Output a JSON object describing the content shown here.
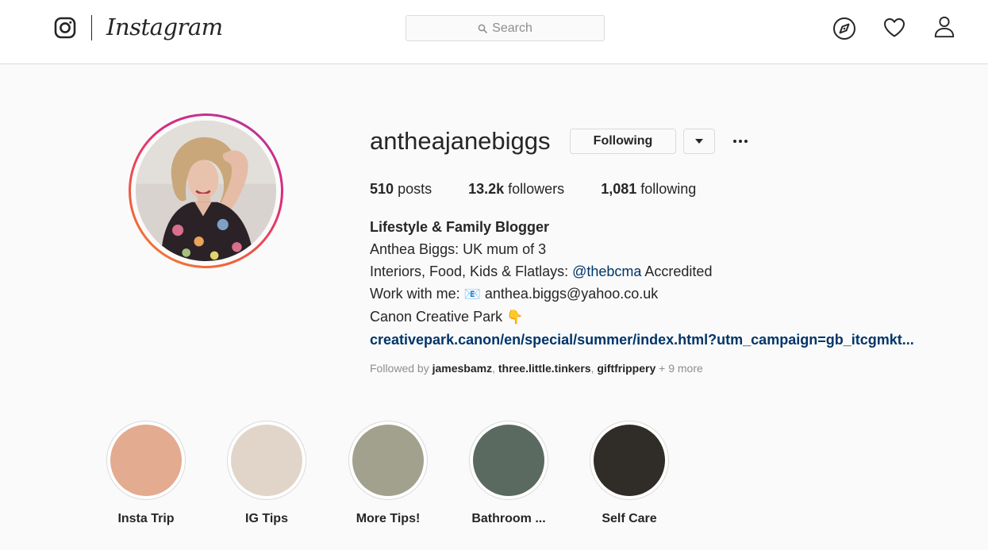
{
  "nav": {
    "logo_text": "Instagram",
    "search_placeholder": "Search",
    "icons": [
      "instagram-glyph-icon",
      "search-icon",
      "compass-icon",
      "heart-icon",
      "person-icon"
    ]
  },
  "profile": {
    "username": "antheajanebiggs",
    "following_button": "Following",
    "stats": [
      {
        "count": "510",
        "label": "posts"
      },
      {
        "count": "13.2k",
        "label": "followers"
      },
      {
        "count": "1,081",
        "label": "following"
      }
    ],
    "bio": {
      "name": "Lifestyle & Family Blogger",
      "line1": "Anthea Biggs: UK mum of 3",
      "line2_prefix": "Interiors, Food, Kids & Flatlays: ",
      "line2_mention": "@thebcma",
      "line2_suffix": " Accredited",
      "line3_prefix": "Work with me: ",
      "line3_emoji": "📧",
      "line3_email": " anthea.biggs@yahoo.co.uk",
      "line4_text": "Canon Creative Park ",
      "line4_emoji": "👇",
      "link": "creativepark.canon/en/special/summer/index.html?utm_campaign=gb_itcgmkt..."
    },
    "followed_by": {
      "prefix": "Followed by ",
      "accounts": [
        "jamesbamz",
        "three.little.tinkers",
        "giftfrippery"
      ],
      "sep": ", ",
      "more": " + 9 more"
    }
  },
  "highlights": [
    {
      "label": "Insta Trip",
      "color": "#e3ab8f"
    },
    {
      "label": "IG Tips",
      "color": "#e0d5c8"
    },
    {
      "label": "More Tips!",
      "color": "#a1a18e"
    },
    {
      "label": "Bathroom ...",
      "color": "#5a6a61"
    },
    {
      "label": "Self Care",
      "color": "#302c27"
    }
  ],
  "colors": {
    "text": "#262626",
    "secondary": "#8e8e8e",
    "link": "#003569",
    "border": "#dbdbdb",
    "background": "#fafafa"
  }
}
